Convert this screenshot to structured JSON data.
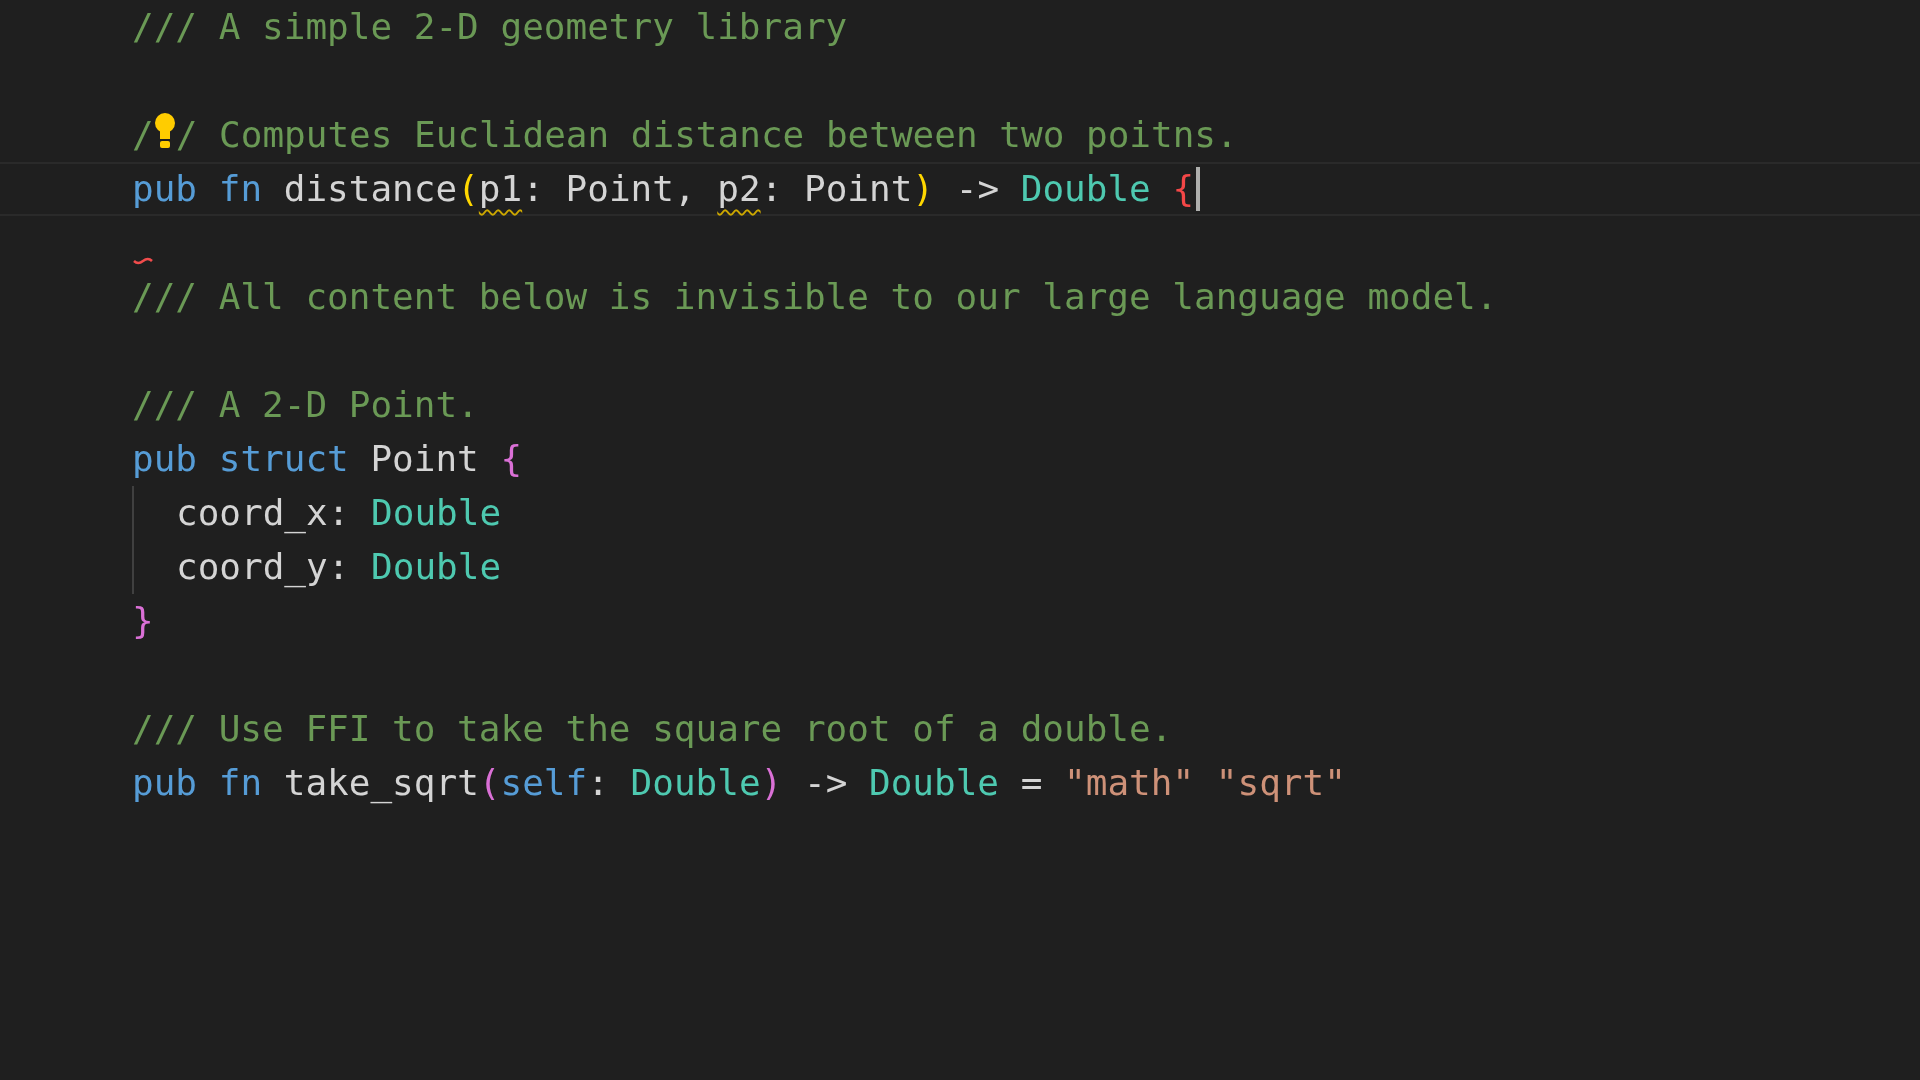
{
  "editor": {
    "lines": [
      {
        "tokens": [
          {
            "text": "/// A simple 2-D geometry library",
            "kind": "comment"
          }
        ]
      },
      {
        "error_marker": false
      },
      {
        "lightbulb": true,
        "tokens": [
          {
            "text": "/",
            "kind": "comment"
          },
          {
            "text": "/ Computes Euclidean distance between two poitns.",
            "kind": "comment"
          }
        ]
      },
      {
        "current": true,
        "cursor": true,
        "tokens": [
          {
            "text": "pub",
            "kind": "keyword",
            "warning": false
          },
          {
            "text": " fn",
            "kind": "keyword",
            "warning": false
          },
          {
            "text": " distance",
            "kind": "plain",
            "warning": false
          },
          {
            "text": "(",
            "kind": "bracket1",
            "warning": false
          },
          {
            "text": "p1",
            "kind": "plain",
            "warning": true
          },
          {
            "text": ": Point, ",
            "kind": "plain",
            "warning": false
          },
          {
            "text": "p2",
            "kind": "plain",
            "warning": true
          },
          {
            "text": ": Point",
            "kind": "plain",
            "warning": false
          },
          {
            "text": ")",
            "kind": "bracket1",
            "warning": false
          },
          {
            "text": " -> ",
            "kind": "plain",
            "warning": false
          },
          {
            "text": "Double",
            "kind": "type",
            "warning": false
          },
          {
            "text": " {",
            "kind": "bracket_error",
            "warning": false
          }
        ]
      },
      {
        "error_marker": true
      },
      {
        "tokens": [
          {
            "text": "/// All content below is invisible to our large language model.",
            "kind": "comment"
          }
        ]
      },
      {
        "error_marker": false
      },
      {
        "tokens": [
          {
            "text": "/// A 2-D Point.",
            "kind": "comment"
          }
        ]
      },
      {
        "tokens": [
          {
            "text": "pub",
            "kind": "keyword"
          },
          {
            "text": " struct",
            "kind": "keyword"
          },
          {
            "text": " Point ",
            "kind": "plain"
          },
          {
            "text": "{",
            "kind": "bracket2"
          }
        ]
      },
      {
        "indent_guide": true,
        "tokens": [
          {
            "text": "coord_x: ",
            "kind": "plain"
          },
          {
            "text": "Double",
            "kind": "type"
          }
        ]
      },
      {
        "indent_guide": true,
        "tokens": [
          {
            "text": "coord_y: ",
            "kind": "plain"
          },
          {
            "text": "Double",
            "kind": "type"
          }
        ]
      },
      {
        "tokens": [
          {
            "text": "}",
            "kind": "bracket2"
          }
        ]
      },
      {
        "error_marker": false
      },
      {
        "tokens": [
          {
            "text": "/// Use FFI to take the square root of a double.",
            "kind": "comment"
          }
        ]
      },
      {
        "tokens": [
          {
            "text": "pub",
            "kind": "keyword"
          },
          {
            "text": " fn",
            "kind": "keyword"
          },
          {
            "text": " take_sqrt",
            "kind": "plain"
          },
          {
            "text": "(",
            "kind": "bracket2"
          },
          {
            "text": "self",
            "kind": "keyword"
          },
          {
            "text": ": ",
            "kind": "plain"
          },
          {
            "text": "Double",
            "kind": "type"
          },
          {
            "text": ")",
            "kind": "bracket2"
          },
          {
            "text": " -> ",
            "kind": "plain"
          },
          {
            "text": "Double",
            "kind": "type"
          },
          {
            "text": " = ",
            "kind": "plain"
          },
          {
            "text": "\"math\" ",
            "kind": "string"
          },
          {
            "text": "\"sqrt\"",
            "kind": "string"
          }
        ]
      }
    ]
  }
}
